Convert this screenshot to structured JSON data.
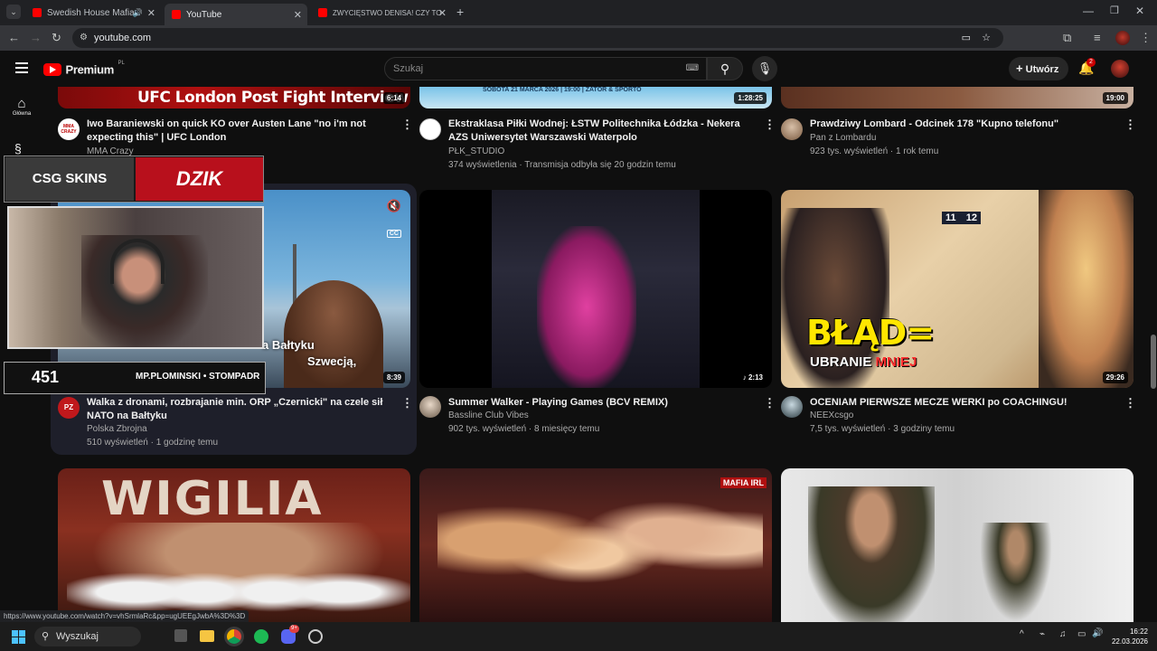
{
  "browser": {
    "tabs": [
      {
        "label": "Swedish House Mafia - Wa",
        "active": false
      },
      {
        "label": "YouTube",
        "active": true
      },
      {
        "label": "ZWYCIĘSTWO DENISA! CZY TO",
        "active": false
      }
    ],
    "url": "youtube.com",
    "status_url": "https://www.youtube.com/watch?v=vhSrmlaRc&pp=ugUEEgJwbA%3D%3D"
  },
  "youtube": {
    "logo_text": "Premium",
    "logo_badge": "PL",
    "search_placeholder": "Szukaj",
    "create_label": "Utwórz",
    "notification_count": "2",
    "rail": {
      "home_label": "Główna"
    }
  },
  "videos": [
    {
      "title": "Iwo Baraniewski on quick KO over Austen Lane \"no i'm not expecting this\" | UFC London",
      "channel": "MMA Crazy",
      "meta": "",
      "duration": "6:14",
      "thumb_text": "UFC London Post Fight Interview",
      "avatar_text": "MMA CRAZY"
    },
    {
      "title": "Ekstraklasa Piłki Wodnej: ŁSTW Politechnika Łódzka - Nekera AZS Uniwersytet Warszawski Waterpolo",
      "channel": "PŁK_STUDIO",
      "meta": "374 wyświetlenia · Transmisja odbyła się 20 godzin temu",
      "duration": "1:28:25",
      "thumb_text": "SOBOTA 21 MARCA 2026 | 19:00 | ZATOR & SPORTO"
    },
    {
      "title": "Prawdziwy Lombard - Odcinek 178 \"Kupno telefonu\"",
      "channel": "Pan z Lombardu",
      "meta": "923 tys. wyświetleń · 1 rok temu",
      "duration": "19:00"
    },
    {
      "title": "Walka z dronami, rozbrajanie min. ORP „Czernicki\" na czele sił NATO na Bałtyku",
      "channel": "Polska Zbrojna",
      "meta": "510 wyświetleń · 1 godzinę temu",
      "duration": "8:39",
      "thumb_text": "a Bałtyku",
      "thumb_text2": "Szwecją,"
    },
    {
      "title": "Summer Walker - Playing Games (BCV REMIX)",
      "channel": "Bassline Club Vibes",
      "meta": "902 tys. wyświetleń · 8 miesięcy temu",
      "duration": "2:13"
    },
    {
      "title": "OCENIAM PIERWSZE MECZE WERKI po COACHINGU!",
      "channel": "NEEXcsgo",
      "meta": "7,5 tys. wyświetleń · 3 godziny temu",
      "duration": "29:26",
      "thumb_text": "BŁĄD=",
      "thumb_text2": "UBRANIE",
      "thumb_text3": "MNIEJ",
      "score_left": "11",
      "score_right": "12"
    },
    {
      "thumb_text": "WIGILIA"
    },
    {
      "thumb_text": "MAFIA IRL"
    },
    {}
  ],
  "overlay": {
    "sponsor1": "CSG SKINS",
    "sponsor2": "DZIK",
    "viewer_count": "451",
    "socials": "MP.PLOMINSKI • STOMPADR"
  },
  "taskbar": {
    "search_placeholder": "Wyszukaj",
    "time": "16:22",
    "date": "22.03.2026",
    "discord_badge": "9+"
  },
  "colors": {
    "youtube_red": "#ff0000",
    "bg": "#0f0f0f",
    "meta_text": "#aaaaaa"
  }
}
